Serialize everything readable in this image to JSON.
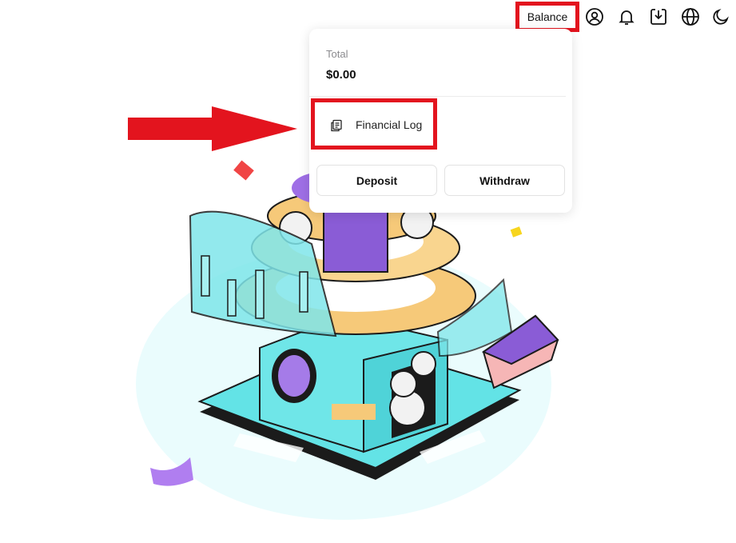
{
  "header": {
    "balance_label": "Balance",
    "icons": [
      "user-icon",
      "bell-icon",
      "download-icon",
      "globe-icon",
      "moon-icon"
    ]
  },
  "balance_menu": {
    "total_label": "Total",
    "total_value": "$0.00",
    "financial_log_label": "Financial Log",
    "deposit_label": "Deposit",
    "withdraw_label": "Withdraw"
  },
  "colors": {
    "highlight_red": "#e3141e",
    "teal": "#5ce1e6",
    "purple": "#9b6ae8",
    "gold": "#f6c979"
  }
}
